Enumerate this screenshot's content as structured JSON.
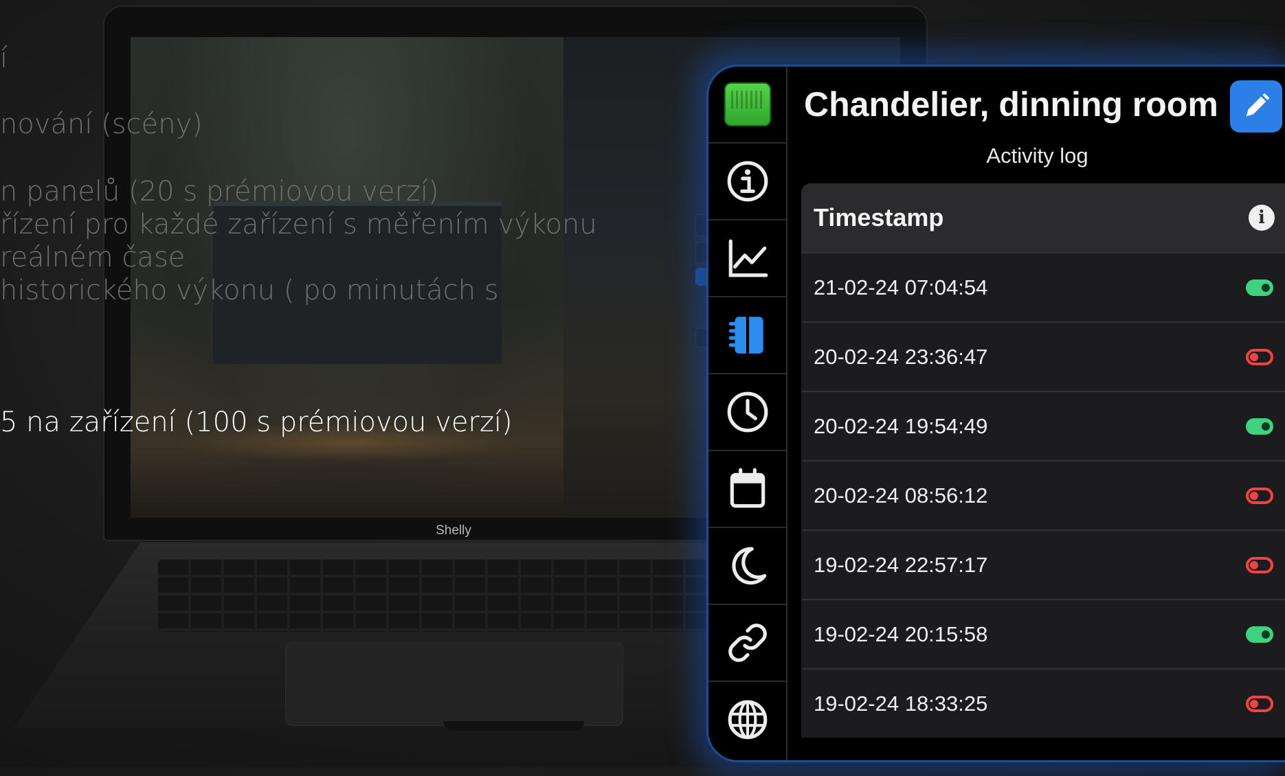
{
  "background": {
    "laptop_brand": "Shelly",
    "slide_lines": [
      "í",
      "nování (scény)",
      "n panelů (20 s prémiovou verzí)",
      "řízení pro každé zařízení s měřením výkonu",
      "reálném čase",
      " historického výkonu ( po minutách s",
      "5 na zařízení (100 s prémiovou verzí)"
    ]
  },
  "app": {
    "title": "Chandelier, dinning room",
    "subtitle": "Activity log",
    "sidebar": [
      {
        "icon": "device-thumbnail"
      },
      {
        "icon": "info-icon"
      },
      {
        "icon": "chart-line-icon"
      },
      {
        "icon": "log-book-icon",
        "active": true
      },
      {
        "icon": "clock-icon"
      },
      {
        "icon": "calendar-icon"
      },
      {
        "icon": "moon-icon"
      },
      {
        "icon": "link-icon"
      },
      {
        "icon": "globe-icon"
      }
    ],
    "table": {
      "header": "Timestamp",
      "rows": [
        {
          "time": "21-02-24 07:04:54",
          "state": "on"
        },
        {
          "time": "20-02-24 23:36:47",
          "state": "off"
        },
        {
          "time": "20-02-24 19:54:49",
          "state": "on"
        },
        {
          "time": "20-02-24 08:56:12",
          "state": "off"
        },
        {
          "time": "19-02-24 22:57:17",
          "state": "off"
        },
        {
          "time": "19-02-24 20:15:58",
          "state": "on"
        },
        {
          "time": "19-02-24 18:33:25",
          "state": "off"
        }
      ]
    },
    "colors": {
      "accent": "#2c7fe6",
      "on": "#3fd27f",
      "off": "#f14343"
    }
  }
}
